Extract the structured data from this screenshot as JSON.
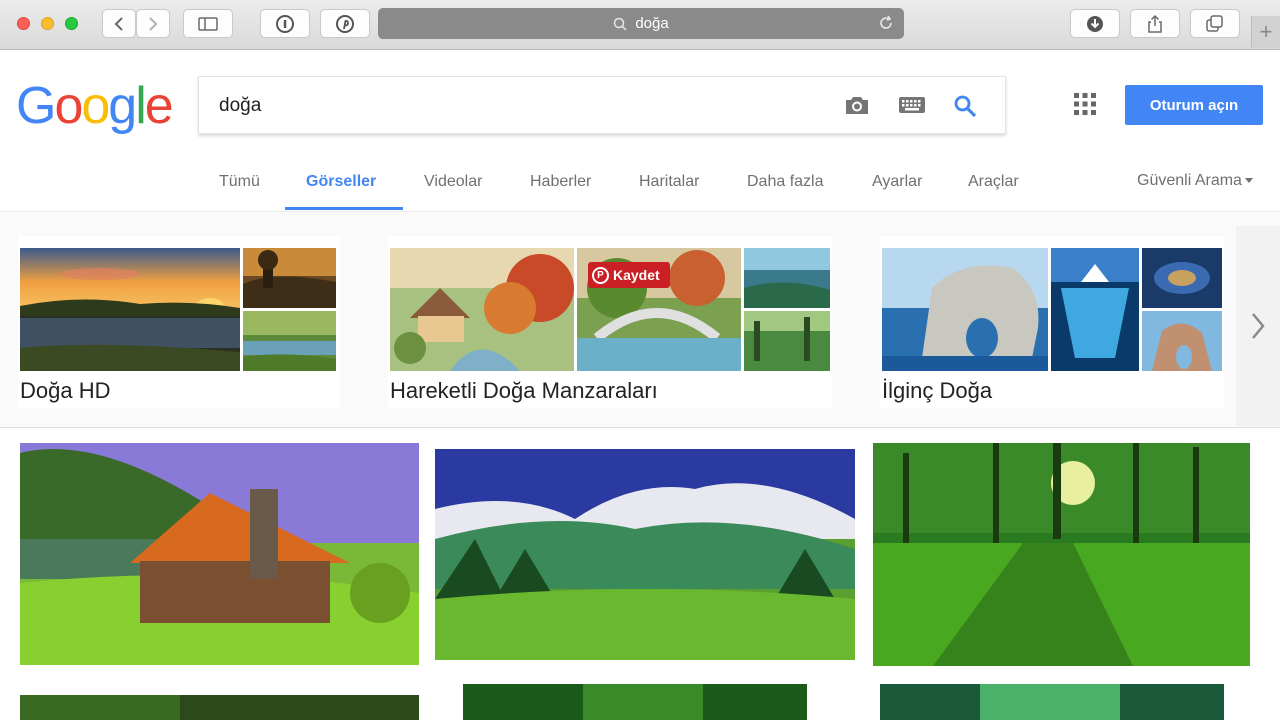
{
  "browser": {
    "url_text": "doğa"
  },
  "google": {
    "logo_letters": [
      {
        "ch": "G",
        "color": "#4285f4"
      },
      {
        "ch": "o",
        "color": "#ea4335"
      },
      {
        "ch": "o",
        "color": "#fbbc05"
      },
      {
        "ch": "g",
        "color": "#4285f4"
      },
      {
        "ch": "l",
        "color": "#34a853"
      },
      {
        "ch": "e",
        "color": "#ea4335"
      }
    ],
    "search_value": "doğa",
    "signin_label": "Oturum açın",
    "accent_color": "#4285f4"
  },
  "tabs": [
    {
      "label": "Tümü",
      "active": false
    },
    {
      "label": "Görseller",
      "active": true
    },
    {
      "label": "Videolar",
      "active": false
    },
    {
      "label": "Haberler",
      "active": false
    },
    {
      "label": "Haritalar",
      "active": false
    },
    {
      "label": "Daha fazla",
      "active": false
    },
    {
      "label": "Ayarlar",
      "active": false
    },
    {
      "label": "Araçlar",
      "active": false
    }
  ],
  "safe_search_label": "Güvenli Arama",
  "collections": [
    {
      "label": "Doğa HD"
    },
    {
      "label": "Hareketli Doğa Manzaraları"
    },
    {
      "label": "İlginç Doğa"
    }
  ],
  "pin_button_label": "Kaydet"
}
